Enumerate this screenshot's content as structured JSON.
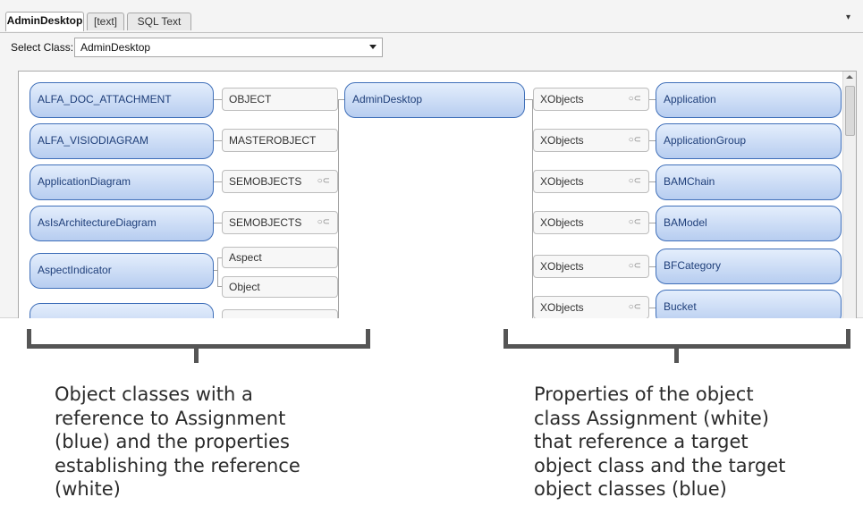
{
  "tabs": [
    {
      "label": "AdminDesktop",
      "active": true
    },
    {
      "label": "[text]",
      "active": false
    },
    {
      "label": "SQL Text",
      "active": false
    }
  ],
  "tab_menu_glyph": "▾",
  "selector": {
    "label": "Select Class:",
    "value": "AdminDesktop"
  },
  "diagram": {
    "center_class": "AdminDesktop",
    "referencing_classes": [
      {
        "name": "ALFA_DOC_ATTACHMENT",
        "properties": [
          "OBJECT"
        ]
      },
      {
        "name": "ALFA_VISIODIAGRAM",
        "properties": [
          "MASTEROBJECT"
        ]
      },
      {
        "name": "ApplicationDiagram",
        "properties": [
          "SEMOBJECTS"
        ]
      },
      {
        "name": "AsIsArchitectureDiagram",
        "properties": [
          "SEMOBJECTS"
        ]
      },
      {
        "name": "AspectIndicator",
        "properties": [
          "Aspect",
          "Object"
        ]
      }
    ],
    "outgoing": [
      {
        "property": "XObjects",
        "target": "Application"
      },
      {
        "property": "XObjects",
        "target": "ApplicationGroup"
      },
      {
        "property": "XObjects",
        "target": "BAMChain"
      },
      {
        "property": "XObjects",
        "target": "BAModel"
      },
      {
        "property": "XObjects",
        "target": "BFCategory"
      },
      {
        "property": "XObjects",
        "target": "Bucket"
      }
    ],
    "link_icon": "link-icon",
    "colors": {
      "class_node_border": "#3f6fb9",
      "class_node_fill": "#b7cdf0",
      "property_fill": "#f7f7f7"
    }
  },
  "captions": {
    "left": "Object classes with a\nreference to Assignment\n(blue) and the properties\nestablishing the reference\n(white)",
    "right": "Properties of the object\nclass Assignment (white)\nthat reference a target\nobject class and the target\nobject classes (blue)"
  }
}
